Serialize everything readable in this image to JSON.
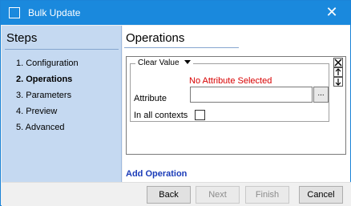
{
  "window": {
    "title": "Bulk Update",
    "close_glyph": "✕"
  },
  "sidebar": {
    "title": "Steps",
    "steps": [
      {
        "label": "1. Configuration",
        "active": false
      },
      {
        "label": "2. Operations",
        "active": true
      },
      {
        "label": "3. Parameters",
        "active": false
      },
      {
        "label": "4. Preview",
        "active": false
      },
      {
        "label": "5. Advanced",
        "active": false
      }
    ]
  },
  "main": {
    "title": "Operations",
    "operation": {
      "type_label": "Clear Value",
      "error": "No Attribute Selected",
      "attribute_label": "Attribute",
      "attribute_value": "",
      "browse_label": "...",
      "contexts_label": "In all contexts",
      "contexts_checked": false
    },
    "add_operation_link": "Add Operation"
  },
  "buttons": {
    "back": "Back",
    "next": "Next",
    "finish": "Finish",
    "cancel": "Cancel"
  },
  "colors": {
    "titlebar": "#1a89dd",
    "sidebar": "#c5d9f1",
    "error": "#d80000",
    "link": "#1a3bb8"
  }
}
